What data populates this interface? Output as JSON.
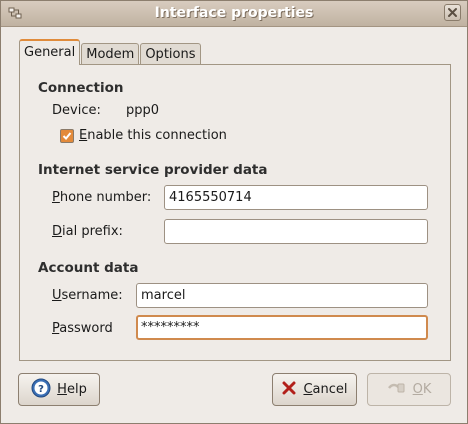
{
  "window": {
    "title": "Interface properties"
  },
  "tabs": [
    {
      "label": "General",
      "active": true
    },
    {
      "label": "Modem",
      "active": false
    },
    {
      "label": "Options",
      "active": false
    }
  ],
  "connection": {
    "heading": "Connection",
    "device_label": "Device:",
    "device_value": "ppp0",
    "enable_label_underlined": "E",
    "enable_label_rest": "nable this connection",
    "enable_checked": true
  },
  "isp": {
    "heading": "Internet service provider data",
    "phone_label_underlined": "P",
    "phone_label_rest": "hone number:",
    "phone_value": "4165550714",
    "dial_label_underlined": "D",
    "dial_label_rest": "ial prefix:",
    "dial_value": ""
  },
  "account": {
    "heading": "Account data",
    "username_label_underlined": "U",
    "username_label_rest": "sername:",
    "username_value": "marcel",
    "password_label_underlined": "P",
    "password_label_rest": "assword",
    "password_value": "*********"
  },
  "buttons": {
    "help_underlined": "H",
    "help_rest": "elp",
    "cancel_underlined": "C",
    "cancel_rest": "ancel",
    "ok_underlined": "O",
    "ok_rest": "K"
  },
  "colors": {
    "accent": "#e08b3b",
    "titlebar": "#c9bba9",
    "background": "#efebe7"
  },
  "icons": {
    "window": "network-icon",
    "close": "close-icon",
    "help": "help-icon",
    "cancel": "cancel-icon",
    "ok": "ok-icon"
  }
}
